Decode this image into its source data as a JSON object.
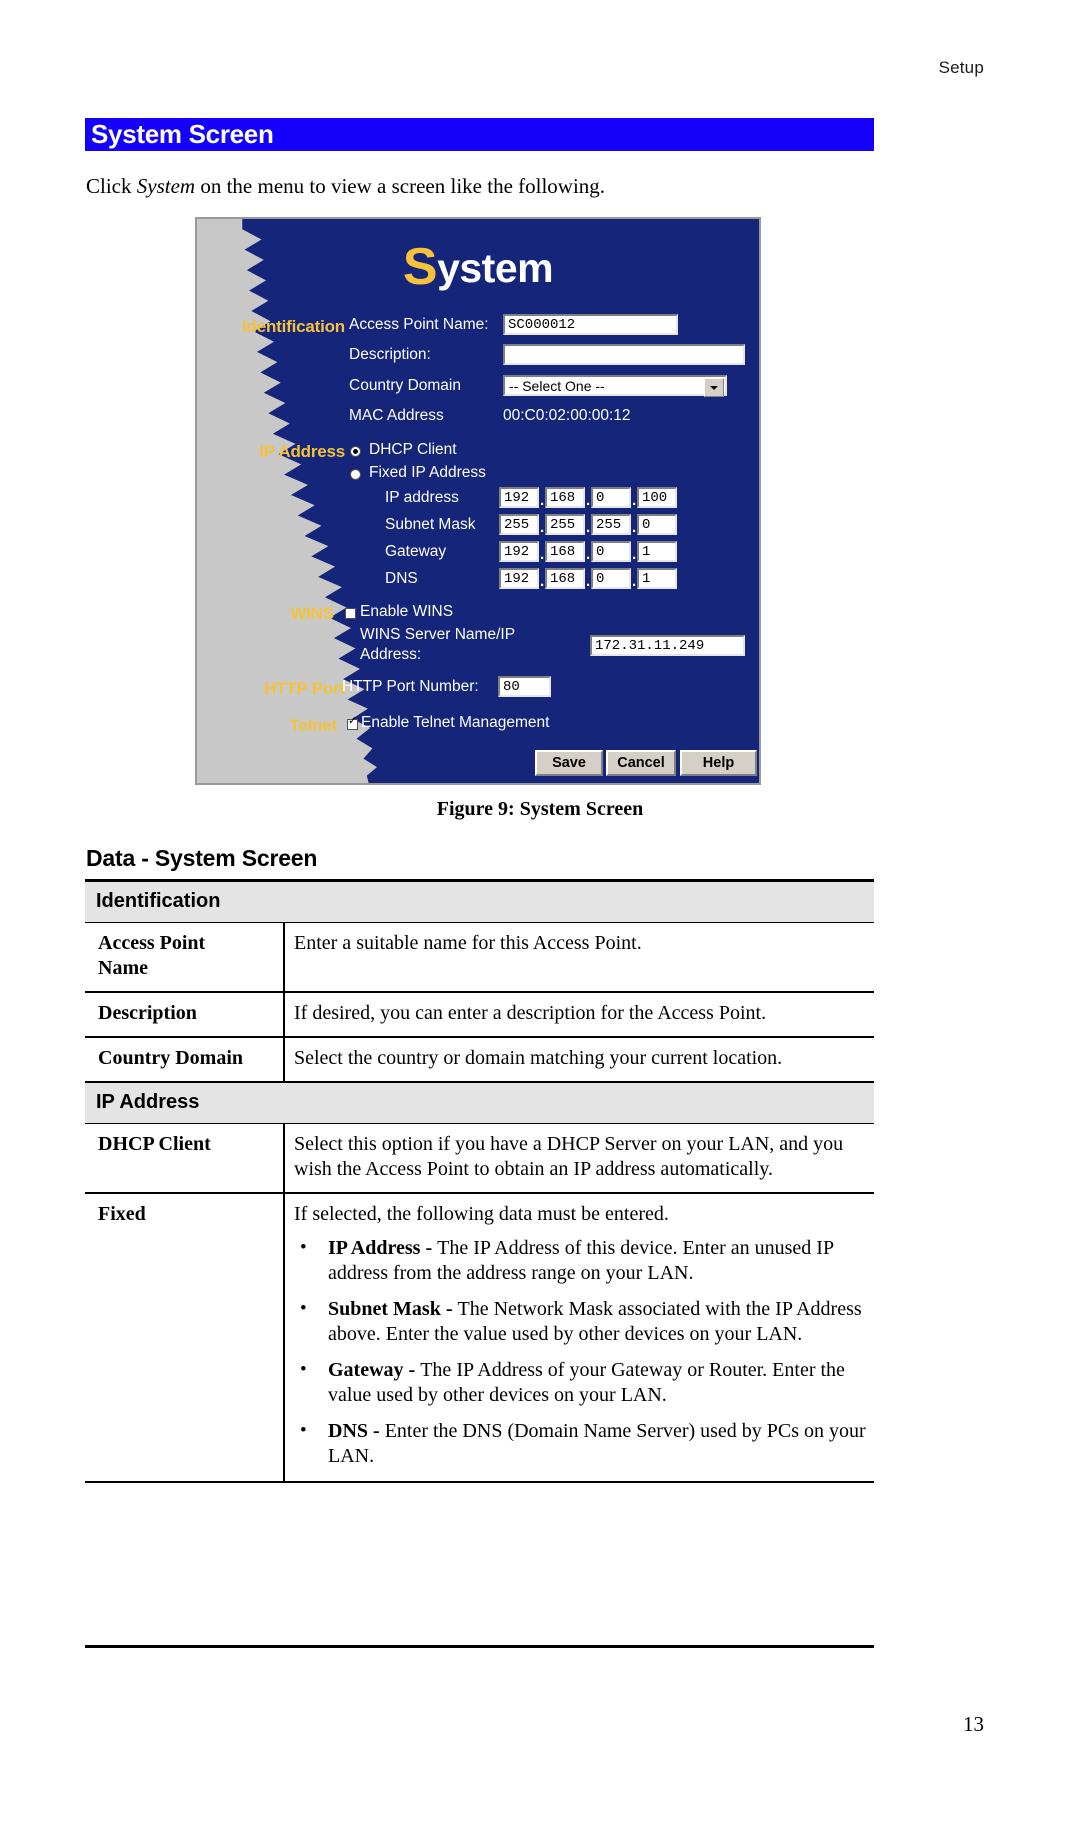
{
  "document": {
    "running_head": "Setup",
    "page_number": "13",
    "chapter_title": "System Screen",
    "intro_before": "Click ",
    "intro_italic": "System",
    "intro_after": " on the menu to view a screen like the following.",
    "figure_caption": "Figure 9: System Screen",
    "data_heading": "Data - System Screen"
  },
  "screenshot": {
    "heading_initial": "S",
    "heading_rest": "ystem",
    "sections": {
      "identification": "Identification",
      "ip_address": "IP Address",
      "wins": "WINS",
      "http_port": "HTTP Port",
      "telnet": "Telnet"
    },
    "fields": {
      "access_point_name_label": "Access Point Name:",
      "access_point_name_value": "SC000012",
      "description_label": "Description:",
      "description_value": "",
      "country_domain_label": "Country Domain",
      "country_domain_value": "-- Select One --",
      "mac_address_label": "MAC Address",
      "mac_address_value": "00:C0:02:00:00:12",
      "dhcp_client_label": "DHCP Client",
      "fixed_ip_label": "Fixed IP Address",
      "ip_address_label": "IP address",
      "subnet_mask_label": "Subnet Mask",
      "gateway_label": "Gateway",
      "dns_label": "DNS",
      "enable_wins_label": "Enable WINS",
      "wins_server_label_line1": "WINS Server Name/IP",
      "wins_server_label_line2": "Address:",
      "wins_server_value": "172.31.11.249",
      "http_port_label": "HTTP Port Number:",
      "http_port_value": "80",
      "enable_telnet_label": "Enable Telnet Management"
    },
    "octets": {
      "ip_address": [
        "192",
        "168",
        "0",
        "100"
      ],
      "subnet_mask": [
        "255",
        "255",
        "255",
        "0"
      ],
      "gateway": [
        "192",
        "168",
        "0",
        "1"
      ],
      "dns": [
        "192",
        "168",
        "0",
        "1"
      ]
    },
    "buttons": {
      "save": "Save",
      "cancel": "Cancel",
      "help": "Help"
    },
    "colors": {
      "panel_blue": "#152579",
      "accent_yellow": "#f5c23c",
      "torn_grey": "#c8c8c8"
    }
  },
  "data_table": {
    "sections": [
      {
        "heading": "Identification",
        "rows": [
          {
            "key": "Access Point\nName",
            "key_line1": "Access Point",
            "key_line2": "Name",
            "value": "Enter a suitable name for this Access Point."
          },
          {
            "key": "Description",
            "value": "If desired, you can enter a description for the Access Point."
          },
          {
            "key": "Country Domain",
            "value": "Select the country or domain matching your current location."
          }
        ]
      },
      {
        "heading": "IP Address",
        "rows": [
          {
            "key": "DHCP Client",
            "value": "Select this option if you have a DHCP Server on your LAN, and you wish the Access Point to obtain an IP address automatically."
          },
          {
            "key": "Fixed",
            "value": "If selected, the following data must be entered.",
            "bullets": [
              {
                "term": "IP Address",
                "sep": " - ",
                "text": "The IP Address of this device. Enter an unused IP address from the address range on your LAN."
              },
              {
                "term": "Subnet Mask",
                "sep": " - ",
                "text": "The Network Mask associated with the IP Address above. Enter the value used by other devices on your LAN."
              },
              {
                "term": "Gateway",
                "sep": " - ",
                "text": "The IP Address of your Gateway or Router. Enter the value used by other devices on your LAN."
              },
              {
                "term": "DNS",
                "sep": " - ",
                "text": "Enter the DNS (Domain Name Server) used by PCs on your LAN."
              }
            ]
          }
        ]
      }
    ]
  }
}
